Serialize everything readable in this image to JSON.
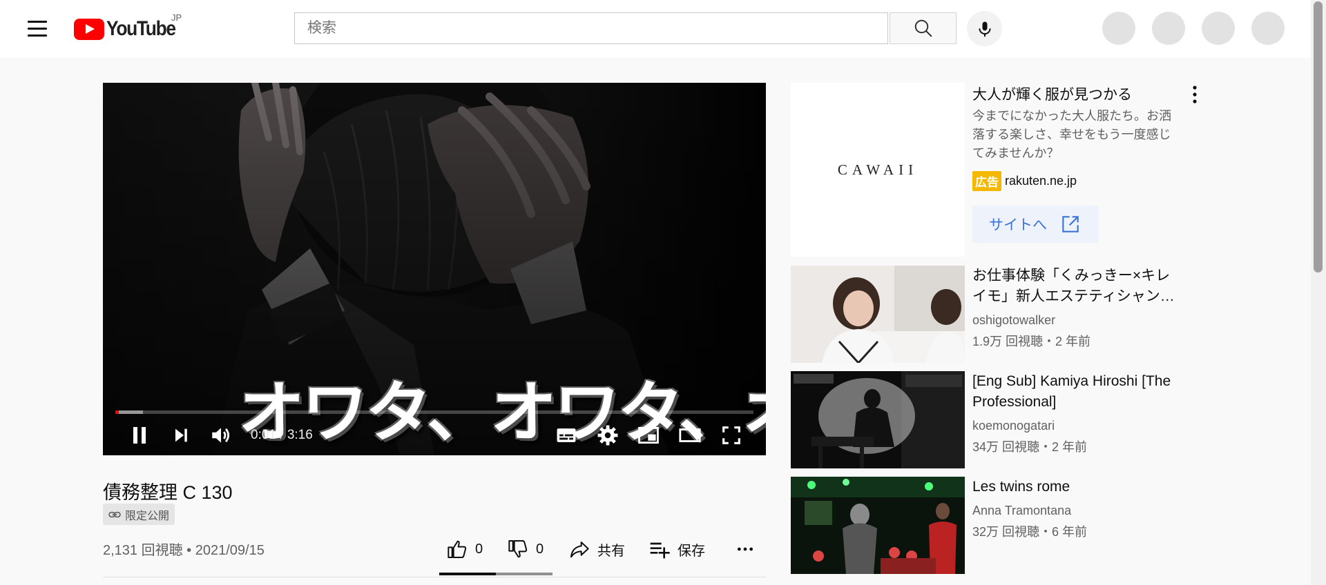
{
  "header": {
    "logo_text": "YouTube",
    "country_code": "JP",
    "search_placeholder": "検索",
    "avatar_count": 4
  },
  "player": {
    "caption": "オワタ、オワタ、オワタッ",
    "time_current": "0:01",
    "time_separator": " / ",
    "time_total": "3:16",
    "played_fraction": 0.005,
    "buffered_fraction": 0.043,
    "state": "playing"
  },
  "video": {
    "title": "債務整理 C 130",
    "privacy": "限定公開",
    "views": "2,131 回視聴",
    "separator": " • ",
    "date": "2021/09/15",
    "likes": "0",
    "dislikes": "0",
    "share_label": "共有",
    "save_label": "保存",
    "like_fraction": 0.5
  },
  "ad": {
    "logo_text": "CAWAII",
    "title": "大人が輝く服が見つかる",
    "description": "今までになかった大人服たち。お洒落する楽しさ、幸せをもう一度感じてみませんか？",
    "badge": "広告",
    "domain": "rakuten.ne.jp",
    "cta_label": "サイトへ"
  },
  "recommendations": [
    {
      "title": "お仕事体験「くみっきー×キレイモ」新人エステティシャン…",
      "channel": "oshigotowalker",
      "stats": "1.9万 回視聴・2 年前"
    },
    {
      "title": "[Eng Sub] Kamiya Hiroshi [The Professional]",
      "channel": "koemonogatari",
      "stats": "34万 回視聴・2 年前"
    },
    {
      "title": "Les twins rome",
      "channel": "Anna Tramontana",
      "stats": "32万 回視聴・6 年前"
    }
  ],
  "colors": {
    "brand_red": "#ff0000",
    "ad_badge": "#f5b800",
    "ad_cta_text": "#3a72d8",
    "page_bg": "#f9f9f9"
  },
  "icons": {
    "menu": "hamburger-menu-icon",
    "search": "search-icon",
    "mic": "microphone-icon",
    "pause": "pause-icon",
    "next": "skip-next-icon",
    "volume": "volume-icon",
    "subtitles": "subtitles-icon",
    "settings": "gear-icon",
    "miniplayer": "miniplayer-icon",
    "theater": "theater-mode-icon",
    "fullscreen": "fullscreen-icon",
    "like": "thumbs-up-icon",
    "dislike": "thumbs-down-icon",
    "share": "share-icon",
    "save": "playlist-add-icon",
    "more": "more-horizontal-icon",
    "link": "link-icon",
    "external": "external-link-icon",
    "ad_menu": "more-vertical-icon"
  }
}
